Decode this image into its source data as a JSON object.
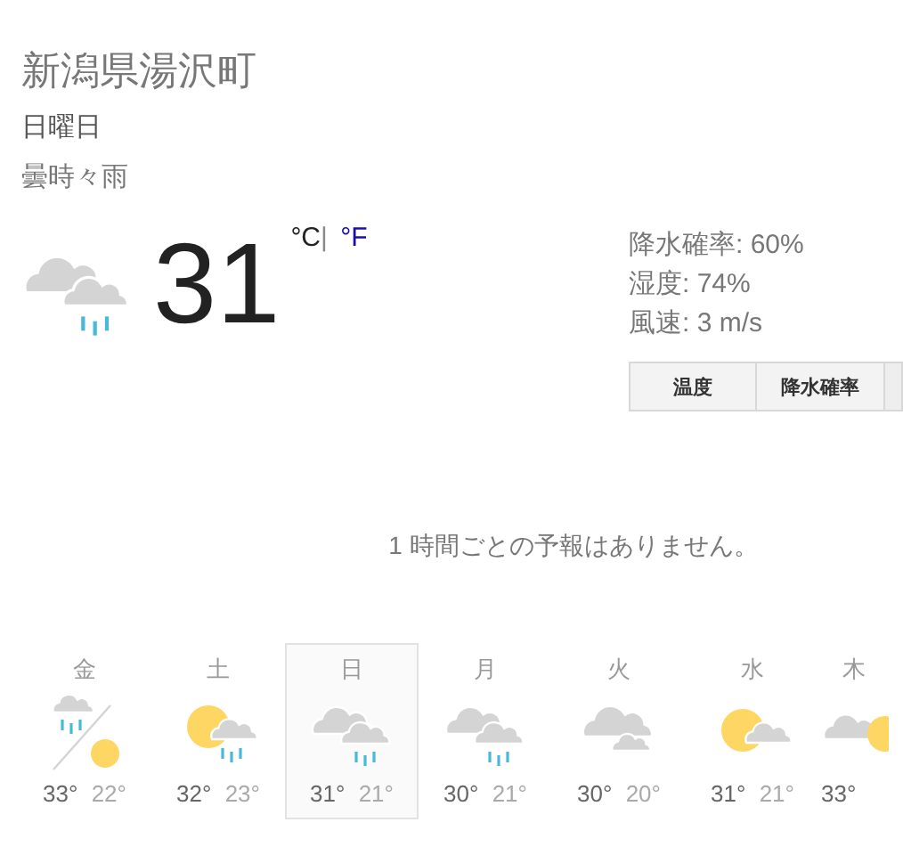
{
  "location": "新潟県湯沢町",
  "day": "日曜日",
  "condition": "曇時々雨",
  "current": {
    "kind": "cloud-rain",
    "temperature": "31",
    "units": [
      {
        "label": "°C",
        "selected": true
      },
      {
        "label": "°F",
        "selected": false
      }
    ],
    "separator": "|"
  },
  "details": [
    "降水確率: 60%",
    "湿度: 74%",
    "風速: 3 m/s"
  ],
  "tabs": [
    {
      "label": "温度"
    },
    {
      "label": "降水確率"
    }
  ],
  "message": "1 時間ごとの予報はありません。",
  "forecast": [
    {
      "day": "金",
      "kind": "rain-sun-split",
      "high": "33°",
      "low": "22°",
      "selected": false
    },
    {
      "day": "土",
      "kind": "sun-rain",
      "high": "32°",
      "low": "23°",
      "selected": false
    },
    {
      "day": "日",
      "kind": "cloud-rain",
      "high": "31°",
      "low": "21°",
      "selected": true
    },
    {
      "day": "月",
      "kind": "cloud-rain",
      "high": "30°",
      "low": "21°",
      "selected": false
    },
    {
      "day": "火",
      "kind": "cloudy",
      "high": "30°",
      "low": "20°",
      "selected": false
    },
    {
      "day": "水",
      "kind": "sun-cloud",
      "high": "31°",
      "low": "21°",
      "selected": false
    },
    {
      "day": "木",
      "kind": "cloud-sun",
      "high": "33°",
      "selected": false
    }
  ]
}
